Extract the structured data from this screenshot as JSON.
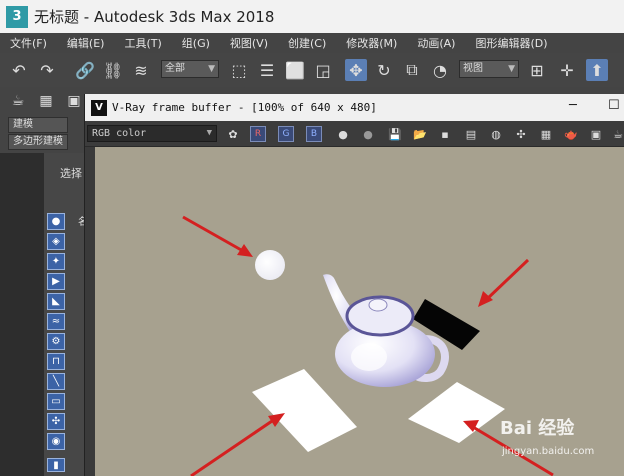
{
  "window": {
    "app_icon": "3ds-max-icon",
    "title": "无标题 - Autodesk 3ds Max 2018"
  },
  "menu": {
    "items": [
      "文件(F)",
      "编辑(E)",
      "工具(T)",
      "组(G)",
      "视图(V)",
      "创建(C)",
      "修改器(M)",
      "动画(A)",
      "图形编辑器(D)"
    ]
  },
  "toolbar": {
    "selection_filter": "全部",
    "reference_coord": "视图"
  },
  "ribbon": {
    "tab_modeling": "建模",
    "tab_poly": "多边形建模"
  },
  "command_panel": {
    "select_label": "选择",
    "name_label": "名"
  },
  "vfb": {
    "title": "V-Ray frame buffer - [100% of 640 x 480]",
    "channel": "RGB color",
    "icon": "vray-icon"
  },
  "watermark": {
    "brand": "Bai 经验",
    "url": "jingyan.baidu.com"
  },
  "colors": {
    "canvas_background": "#a7a18f",
    "teapot": "#e8e6f6",
    "arrow": "#d42020",
    "accent_button": "#3c63a6"
  }
}
